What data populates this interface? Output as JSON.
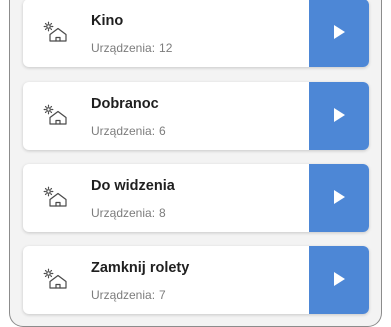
{
  "scenes": [
    {
      "name": "Kino",
      "devices_label": "Urządzenia:",
      "devices_count": "12",
      "icon": "scene-house-icon",
      "action_icon": "play-icon"
    },
    {
      "name": "Dobranoc",
      "devices_label": "Urządzenia:",
      "devices_count": "6",
      "icon": "scene-house-icon",
      "action_icon": "play-icon"
    },
    {
      "name": "Do widzenia",
      "devices_label": "Urządzenia:",
      "devices_count": "8",
      "icon": "scene-house-icon",
      "action_icon": "play-icon"
    },
    {
      "name": "Zamknij rolety",
      "devices_label": "Urządzenia:",
      "devices_count": "7",
      "icon": "scene-house-icon",
      "action_icon": "play-icon"
    }
  ],
  "colors": {
    "accent": "#4d87d6",
    "card_background": "#ffffff",
    "panel_background": "#f3f3f3",
    "title_text": "#1f1f1f",
    "secondary_text": "#7c7c7c"
  }
}
